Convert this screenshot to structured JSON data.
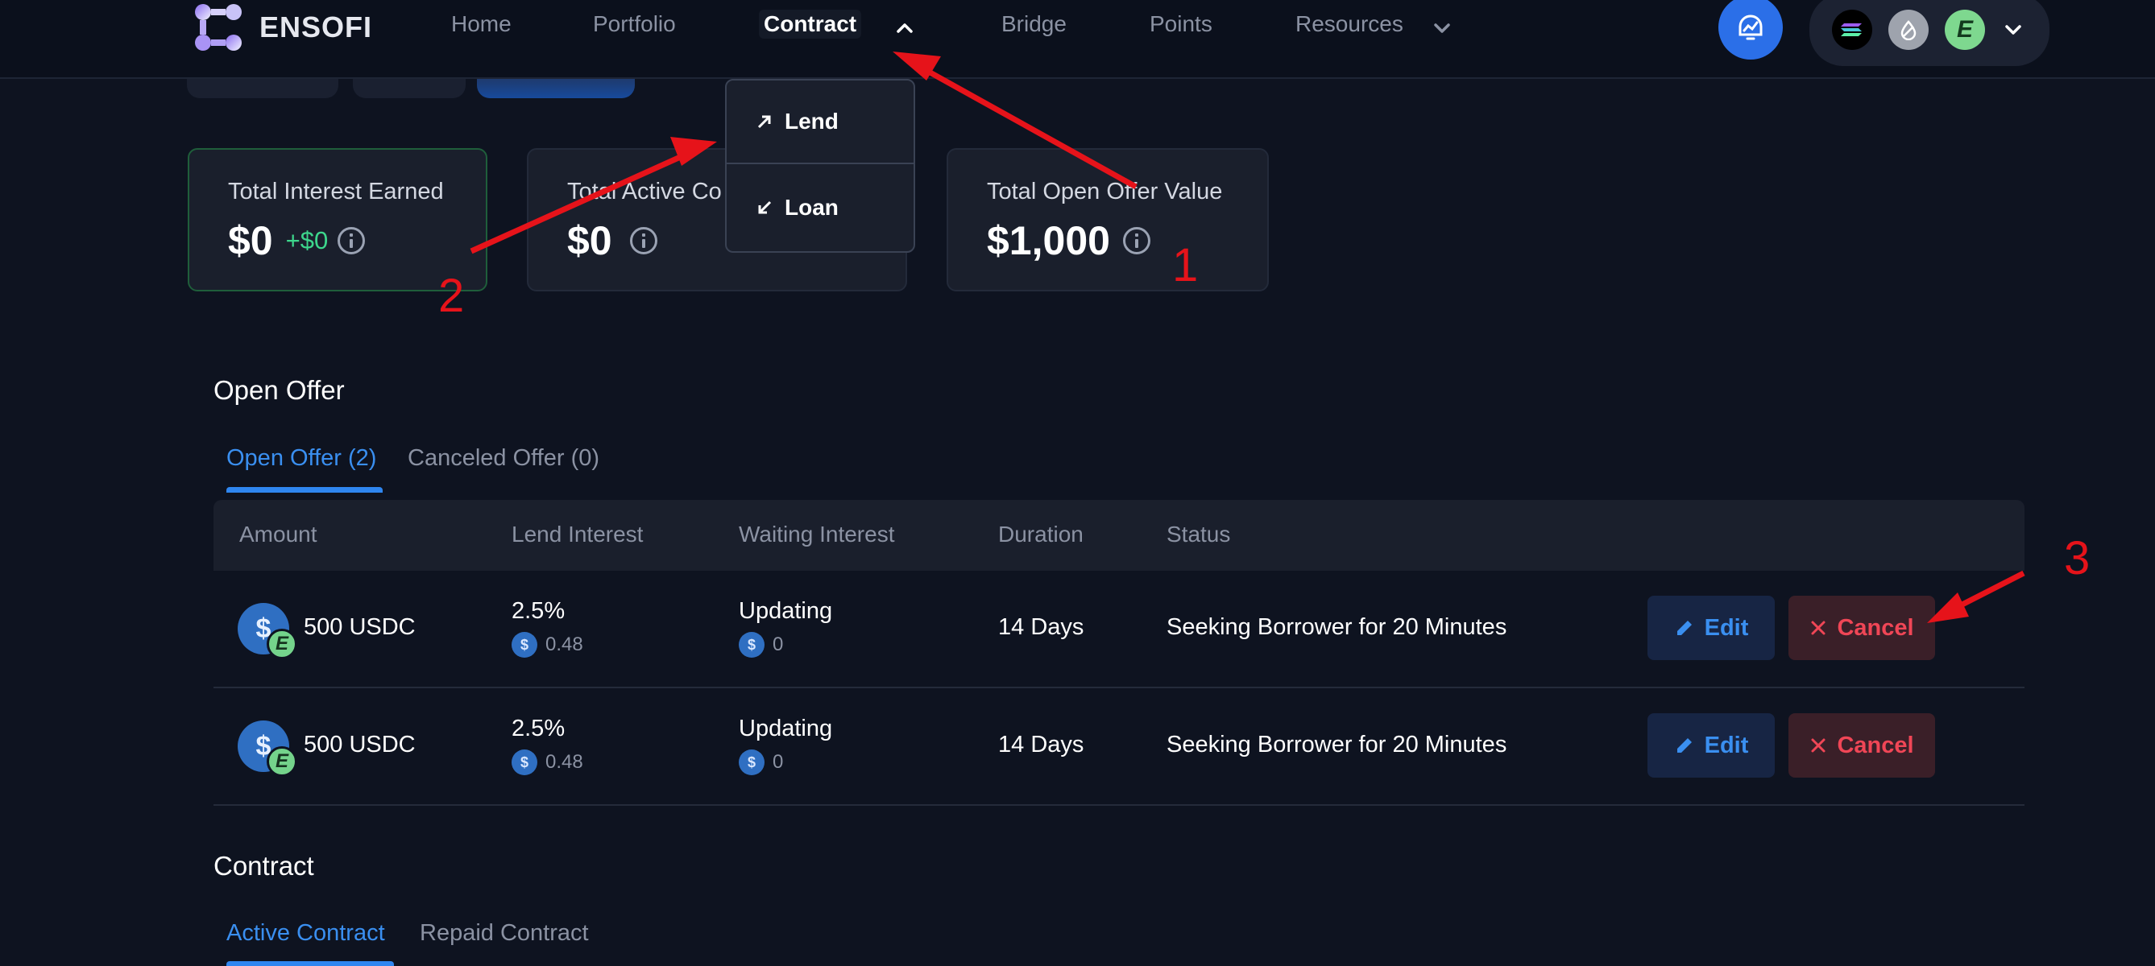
{
  "nav": {
    "logo": "ENSOFI",
    "items": [
      "Home",
      "Portfolio",
      "Contract",
      "Bridge",
      "Points",
      "Resources"
    ]
  },
  "dropdown": {
    "items": [
      "Lend",
      "Loan"
    ]
  },
  "cards": [
    {
      "label": "Total Interest Earned",
      "value": "$0",
      "delta": "+$0"
    },
    {
      "label": "Total Active Co",
      "value": "$0"
    },
    {
      "label": "Total Open Offer Value",
      "value": "$1,000"
    }
  ],
  "open_offer": {
    "title": "Open Offer",
    "tabs": [
      "Open Offer (2)",
      "Canceled Offer (0)"
    ],
    "columns": [
      "Amount",
      "Lend Interest",
      "Waiting Interest",
      "Duration",
      "Status"
    ],
    "rows": [
      {
        "amount": "500 USDC",
        "lend_interest": "2.5%",
        "lend_interest_sub": "0.48",
        "waiting": "Updating",
        "waiting_sub": "0",
        "duration": "14 Days",
        "status": "Seeking Borrower for 20 Minutes"
      },
      {
        "amount": "500 USDC",
        "lend_interest": "2.5%",
        "lend_interest_sub": "0.48",
        "waiting": "Updating",
        "waiting_sub": "0",
        "duration": "14 Days",
        "status": "Seeking Borrower for 20 Minutes"
      }
    ],
    "edit_label": "Edit",
    "cancel_label": "Cancel"
  },
  "contract": {
    "title": "Contract",
    "tabs": [
      "Active Contract",
      "Repaid Contract"
    ]
  },
  "annotations": [
    "1",
    "2",
    "3"
  ],
  "colors": {
    "accent": "#2f86f0",
    "danger": "#f04656",
    "success": "#3dd68c",
    "annotation": "#e6131a"
  }
}
